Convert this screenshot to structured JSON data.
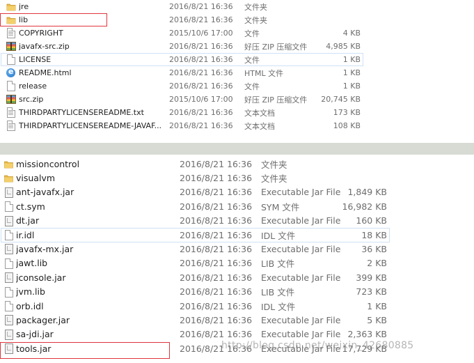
{
  "top_panel": {
    "files": [
      {
        "name": "jre",
        "date": "2016/8/21 16:36",
        "type": "文件夹",
        "size": "",
        "icon": "folder-icon"
      },
      {
        "name": "lib",
        "date": "2016/8/21 16:36",
        "type": "文件夹",
        "size": "",
        "icon": "folder-icon"
      },
      {
        "name": "COPYRIGHT",
        "date": "2015/10/6 17:00",
        "type": "文件",
        "size": "4 KB",
        "icon": "document-icon"
      },
      {
        "name": "javafx-src.zip",
        "date": "2016/8/21 16:36",
        "type": "好压 ZIP 压缩文件",
        "size": "4,985 KB",
        "icon": "zip-archive-icon"
      },
      {
        "name": "LICENSE",
        "date": "2016/8/21 16:36",
        "type": "文件",
        "size": "1 KB",
        "icon": "document-icon"
      },
      {
        "name": "README.html",
        "date": "2016/8/21 16:36",
        "type": "HTML 文件",
        "size": "1 KB",
        "icon": "html-file-icon"
      },
      {
        "name": "release",
        "date": "2016/8/21 16:36",
        "type": "文件",
        "size": "1 KB",
        "icon": "document-icon"
      },
      {
        "name": "src.zip",
        "date": "2015/10/6 17:00",
        "type": "好压 ZIP 压缩文件",
        "size": "20,745 KB",
        "icon": "zip-archive-icon"
      },
      {
        "name": "THIRDPARTYLICENSEREADME.txt",
        "date": "2016/8/21 16:36",
        "type": "文本文档",
        "size": "173 KB",
        "icon": "text-file-icon"
      },
      {
        "name": "THIRDPARTYLICENSEREADME-JAVAF...",
        "date": "2016/8/21 16:36",
        "type": "文本文档",
        "size": "108 KB",
        "icon": "text-file-icon"
      }
    ]
  },
  "bottom_panel": {
    "files": [
      {
        "name": "missioncontrol",
        "date": "2016/8/21 16:36",
        "type": "文件夹",
        "size": "",
        "icon": "folder-icon"
      },
      {
        "name": "visualvm",
        "date": "2016/8/21 16:36",
        "type": "文件夹",
        "size": "",
        "icon": "folder-icon"
      },
      {
        "name": "ant-javafx.jar",
        "date": "2016/8/21 16:36",
        "type": "Executable Jar File",
        "size": "1,849 KB",
        "icon": "jar-file-icon"
      },
      {
        "name": "ct.sym",
        "date": "2016/8/21 16:36",
        "type": "SYM 文件",
        "size": "16,982 KB",
        "icon": "document-icon"
      },
      {
        "name": "dt.jar",
        "date": "2016/8/21 16:36",
        "type": "Executable Jar File",
        "size": "160 KB",
        "icon": "jar-file-icon"
      },
      {
        "name": "ir.idl",
        "date": "2016/8/21 16:36",
        "type": "IDL 文件",
        "size": "18 KB",
        "icon": "document-icon"
      },
      {
        "name": "javafx-mx.jar",
        "date": "2016/8/21 16:36",
        "type": "Executable Jar File",
        "size": "36 KB",
        "icon": "jar-file-icon"
      },
      {
        "name": "jawt.lib",
        "date": "2016/8/21 16:36",
        "type": "LIB 文件",
        "size": "2 KB",
        "icon": "document-icon"
      },
      {
        "name": "jconsole.jar",
        "date": "2016/8/21 16:36",
        "type": "Executable Jar File",
        "size": "399 KB",
        "icon": "jar-file-icon"
      },
      {
        "name": "jvm.lib",
        "date": "2016/8/21 16:36",
        "type": "LIB 文件",
        "size": "723 KB",
        "icon": "document-icon"
      },
      {
        "name": "orb.idl",
        "date": "2016/8/21 16:36",
        "type": "IDL 文件",
        "size": "1 KB",
        "icon": "document-icon"
      },
      {
        "name": "packager.jar",
        "date": "2016/8/21 16:36",
        "type": "Executable Jar File",
        "size": "5 KB",
        "icon": "jar-file-icon"
      },
      {
        "name": "sa-jdi.jar",
        "date": "2016/8/21 16:36",
        "type": "Executable Jar File",
        "size": "2,363 KB",
        "icon": "jar-file-icon"
      },
      {
        "name": "tools.jar",
        "date": "2016/8/21 16:36",
        "type": "Executable Jar File",
        "size": "17,729 KB",
        "icon": "jar-file-icon"
      }
    ]
  },
  "watermark": "http://blog.csdn.net/weixin_42680885",
  "colors": {
    "annotation_box": "#e0343c",
    "hover_outline": "#cfe1f5",
    "divider": "#d7dbd4",
    "folder": "#e9b94a"
  }
}
